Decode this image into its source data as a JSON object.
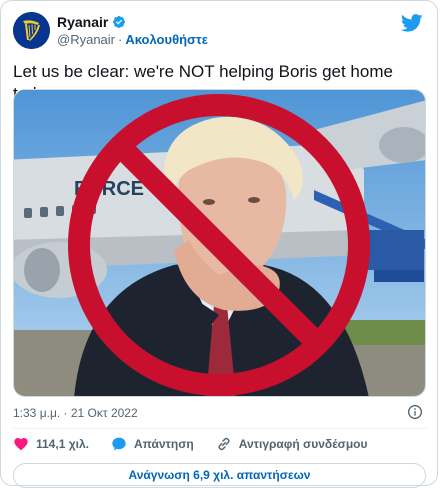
{
  "author": {
    "name": "Ryanair",
    "handle": "@Ryanair",
    "separator": "·",
    "follow_label": "Ακολουθήστε"
  },
  "tweet": {
    "text": "Let us be clear: we're NOT helping Boris get home today",
    "timestamp": "1:33 μ.μ. · 21 Οκτ 2022"
  },
  "media": {
    "plane_text": "FORCE"
  },
  "actions": {
    "likes": "114,1 χιλ.",
    "reply_label": "Απάντηση",
    "copy_link_label": "Αντιγραφή συνδέσμου"
  },
  "read_replies_label": "Ανάγνωση 6,9 χιλ. απαντήσεων",
  "colors": {
    "accent": "#0067b8",
    "like": "#f91880",
    "verified": "#1d9bf0",
    "no_sign": "#c8102e"
  },
  "icons": [
    "ryanair-logo-icon",
    "verified-badge-icon",
    "twitter-bird-icon",
    "info-icon",
    "heart-icon",
    "reply-icon",
    "link-icon"
  ]
}
